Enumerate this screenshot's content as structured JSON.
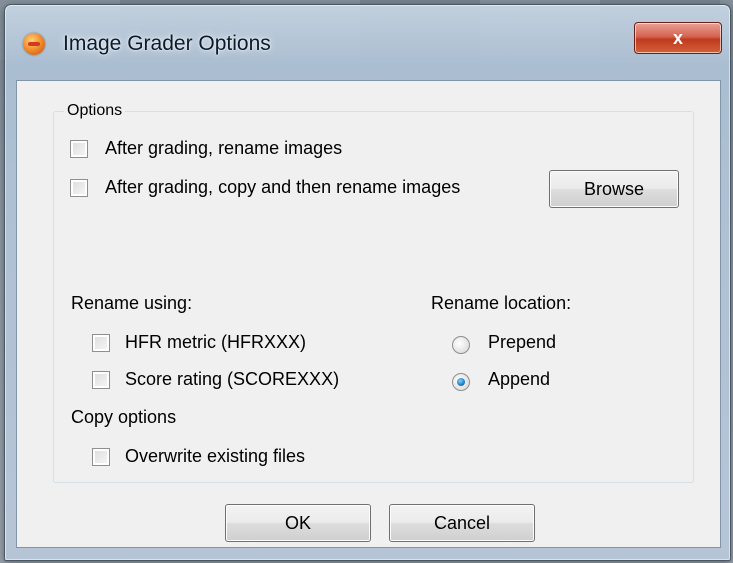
{
  "window": {
    "title": "Image Grader Options",
    "close_label": "x"
  },
  "options_group": {
    "legend": "Options",
    "rename_images": {
      "label": "After grading, rename images",
      "checked": false
    },
    "copy_rename_images": {
      "label": "After grading, copy and then rename images",
      "checked": false
    },
    "browse_label": "Browse",
    "rename_using": {
      "heading": "Rename using:",
      "hfr": {
        "label": "HFR metric (HFRXXX)",
        "checked": false
      },
      "score": {
        "label": "Score rating (SCOREXXX)",
        "checked": false
      }
    },
    "rename_location": {
      "heading": "Rename location:",
      "prepend": {
        "label": "Prepend",
        "selected": false
      },
      "append": {
        "label": "Append",
        "selected": true
      }
    },
    "copy_options": {
      "heading": "Copy options",
      "overwrite": {
        "label": "Overwrite existing files",
        "checked": false
      }
    }
  },
  "buttons": {
    "ok_label": "OK",
    "cancel_label": "Cancel"
  }
}
